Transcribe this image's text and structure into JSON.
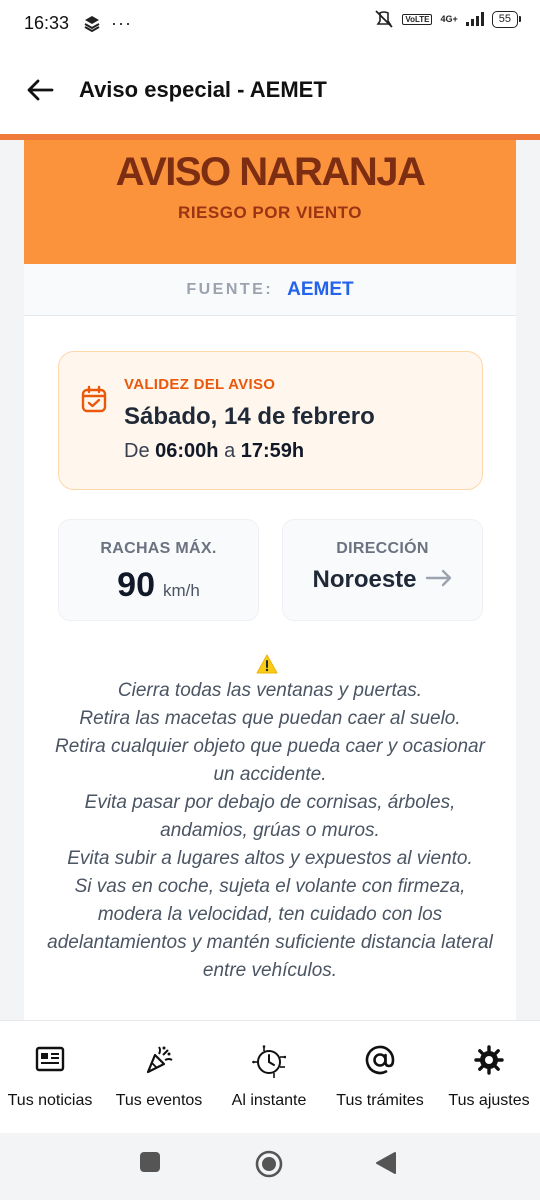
{
  "status_bar": {
    "time": "16:33",
    "more": "···",
    "volte": "VoLTE",
    "network": "4G+",
    "battery": "55"
  },
  "header": {
    "title": "Aviso especial - AEMET",
    "accent_color": "#f07a3a"
  },
  "alert": {
    "level": "AVISO NARANJA",
    "risk": "RIESGO POR VIENTO",
    "banner_color": "#fb923c",
    "source_label": "FUENTE:",
    "source_value": "AEMET"
  },
  "validity": {
    "label": "VALIDEZ DEL AVISO",
    "date": "Sábado, 14 de febrero",
    "from_word": "De",
    "start": "06:00h",
    "to_word": "a",
    "end": "17:59h"
  },
  "stats": {
    "gusts_label": "RACHAS MÁX.",
    "gusts_value": "90",
    "gusts_unit": "km/h",
    "direction_label": "DIRECCIÓN",
    "direction_value": "Noroeste"
  },
  "advice": [
    "Cierra todas las ventanas y puertas.",
    "Retira las macetas que puedan caer al suelo.",
    "Retira cualquier objeto que pueda caer y ocasionar un accidente.",
    "Evita pasar por debajo de cornisas, árboles, andamios, grúas o muros.",
    "Evita subir a lugares altos y expuestos al viento.",
    "Si vas en coche, sujeta el volante con firmeza, modera la velocidad, ten cuidado con los adelantamientos y mantén suficiente distancia lateral entre vehículos."
  ],
  "bottom_nav": {
    "items": [
      {
        "label": "Tus noticias",
        "icon": "newspaper-icon"
      },
      {
        "label": "Tus eventos",
        "icon": "party-popper-icon"
      },
      {
        "label": "Al instante",
        "icon": "circuit-clock-icon"
      },
      {
        "label": "Tus trámites",
        "icon": "at-sign-icon"
      },
      {
        "label": "Tus ajustes",
        "icon": "gear-icon"
      }
    ]
  }
}
